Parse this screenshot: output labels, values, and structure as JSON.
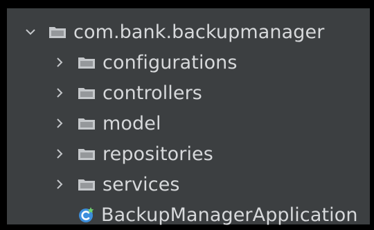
{
  "project_tree": {
    "root": {
      "label": "com.bank.backupmanager",
      "icon": "folder-icon",
      "state": "expanded"
    },
    "children": [
      {
        "label": "configurations",
        "icon": "folder-icon",
        "state": "collapsed"
      },
      {
        "label": "controllers",
        "icon": "folder-icon",
        "state": "collapsed"
      },
      {
        "label": "model",
        "icon": "folder-icon",
        "state": "collapsed"
      },
      {
        "label": "repositories",
        "icon": "folder-icon",
        "state": "collapsed"
      },
      {
        "label": "services",
        "icon": "folder-icon",
        "state": "collapsed"
      },
      {
        "label": "BackupManagerApplication",
        "icon": "spring-boot-class-icon"
      }
    ]
  },
  "colors": {
    "panel_background": "#3c3f41",
    "text": "#d7d9db",
    "folder": "#c5c8cb",
    "class_icon": "#3d8fdc"
  }
}
